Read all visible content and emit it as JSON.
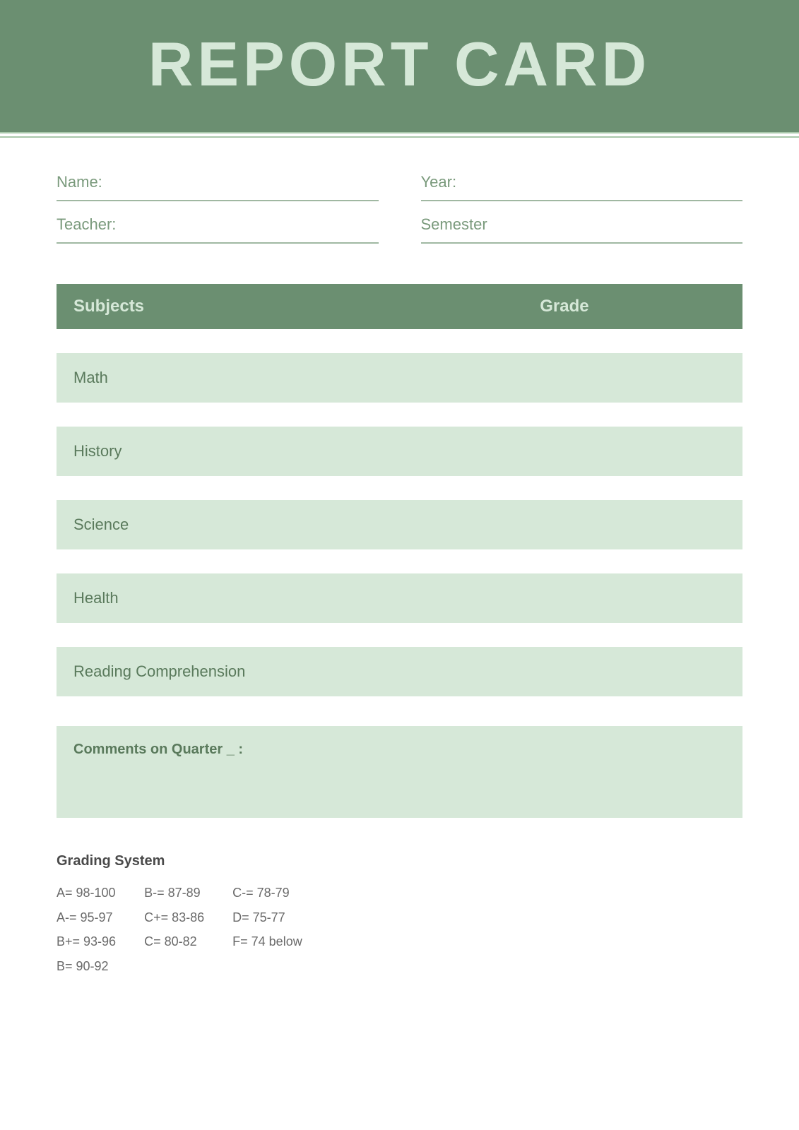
{
  "header": {
    "title": "REPORT CARD"
  },
  "info": {
    "name_label": "Name:",
    "year_label": "Year:",
    "teacher_label": "Teacher:",
    "semester_label": "Semester"
  },
  "table": {
    "subjects_header": "Subjects",
    "grade_header": "Grade",
    "rows": [
      {
        "subject": "Math",
        "grade": ""
      },
      {
        "subject": "History",
        "grade": ""
      },
      {
        "subject": "Science",
        "grade": ""
      },
      {
        "subject": "Health",
        "grade": ""
      },
      {
        "subject": "Reading Comprehension",
        "grade": ""
      }
    ]
  },
  "comments": {
    "label": "Comments on Quarter _ :"
  },
  "grading": {
    "title": "Grading System",
    "col1": [
      "A= 98-100",
      "A-= 95-97",
      "B+= 93-96",
      "B= 90-92"
    ],
    "col2": [
      "B-= 87-89",
      "C+= 83-86",
      "C= 80-82"
    ],
    "col3": [
      "C-= 78-79",
      "D= 75-77",
      "F= 74 below"
    ]
  }
}
